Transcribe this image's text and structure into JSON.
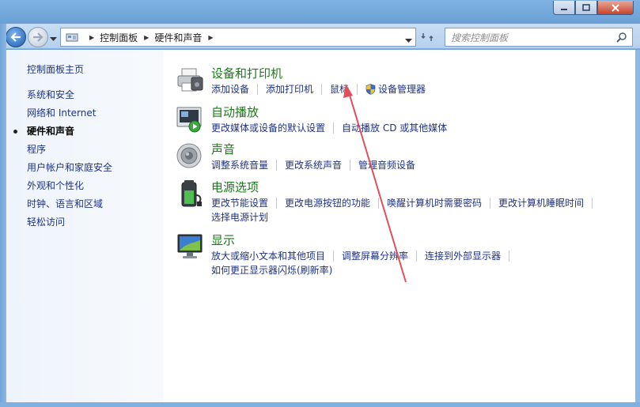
{
  "window": {
    "buttons": [
      "minimize",
      "maximize",
      "close"
    ]
  },
  "navbar": {
    "breadcrumb": [
      "控制面板",
      "硬件和声音"
    ],
    "search_placeholder": "搜索控制面板"
  },
  "leftpane": {
    "home": "控制面板主页",
    "items": [
      {
        "label": "系统和安全",
        "active": false
      },
      {
        "label": "网络和 Internet",
        "active": false
      },
      {
        "label": "硬件和声音",
        "active": true
      },
      {
        "label": "程序",
        "active": false
      },
      {
        "label": "用户帐户和家庭安全",
        "active": false
      },
      {
        "label": "外观和个性化",
        "active": false
      },
      {
        "label": "时钟、语言和区域",
        "active": false
      },
      {
        "label": "轻松访问",
        "active": false
      }
    ]
  },
  "categories": [
    {
      "title": "设备和打印机",
      "icon": "printer-icon",
      "links": [
        "添加设备",
        "添加打印机",
        "鼠标",
        "设备管理器"
      ]
    },
    {
      "title": "自动播放",
      "icon": "autoplay-icon",
      "links": [
        "更改媒体或设备的默认设置",
        "自动播放 CD 或其他媒体"
      ]
    },
    {
      "title": "声音",
      "icon": "speaker-icon",
      "links": [
        "调整系统音量",
        "更改系统声音",
        "管理音频设备"
      ]
    },
    {
      "title": "电源选项",
      "icon": "battery-icon",
      "links": [
        "更改节能设置",
        "更改电源按钮的功能",
        "唤醒计算机时需要密码",
        "更改计算机睡眠时间",
        "选择电源计划"
      ]
    },
    {
      "title": "显示",
      "icon": "monitor-icon",
      "links": [
        "放大或缩小文本和其他项目",
        "调整屏幕分辨率",
        "连接到外部显示器",
        "如何更正显示器闪烁(刷新率)"
      ]
    }
  ],
  "colors": {
    "link": "#1e3287",
    "category_title": "#1a7a1a",
    "annotation_arrow": "#e0505a"
  }
}
